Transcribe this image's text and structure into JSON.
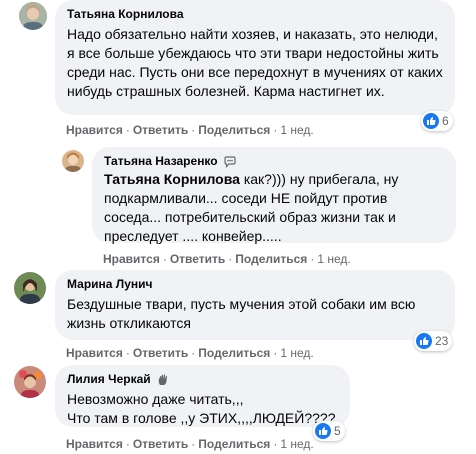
{
  "comments": [
    {
      "author": "Татьяна Корнилова",
      "text": "Надо обязательно найти хозяев, и наказать, это нелюди, я все больше убеждаюсь что эти твари недостойны жить среди нас. Пусть они все передохнут в мучениях от каких нибудь страшных болезней. Карма настигнет их.",
      "like_label": "Нравится",
      "reply_label": "Ответить",
      "share_label": "Поделиться",
      "time": "1 нед.",
      "reaction_count": "6"
    },
    {
      "author": "Татьяна Назаренко",
      "author_badge": "chat-bubble-icon",
      "mention": "Татьяна Корнилова",
      "text": " как?))) ну прибегала, ну подкармливали... соседи НЕ пойдут против соседа... потребительский образ жизни так и преследует .... конвейер.....",
      "like_label": "Нравится",
      "reply_label": "Ответить",
      "share_label": "Поделиться",
      "time": "1 нед."
    },
    {
      "author": "Марина Лунич",
      "text": "Бездушные твари, пусть мучения этой собаки им всю жизнь откликаются",
      "like_label": "Нравится",
      "reply_label": "Ответить",
      "share_label": "Поделиться",
      "time": "1 нед.",
      "reaction_count": "23"
    },
    {
      "author": "Лилия Черкай",
      "author_badge": "waving-hand-icon",
      "text": "Невозможно даже читать,,,\nЧто там в голове ,,у ЭТИХ,,,,ЛЮДЕЙ????",
      "like_label": "Нравится",
      "reply_label": "Ответить",
      "share_label": "Поделиться",
      "time": "1 нед.",
      "reaction_count": "5"
    }
  ],
  "colors": {
    "bubble": "#f0f2f5",
    "meta_text": "#65676b",
    "like_blue": "#1877f2"
  }
}
